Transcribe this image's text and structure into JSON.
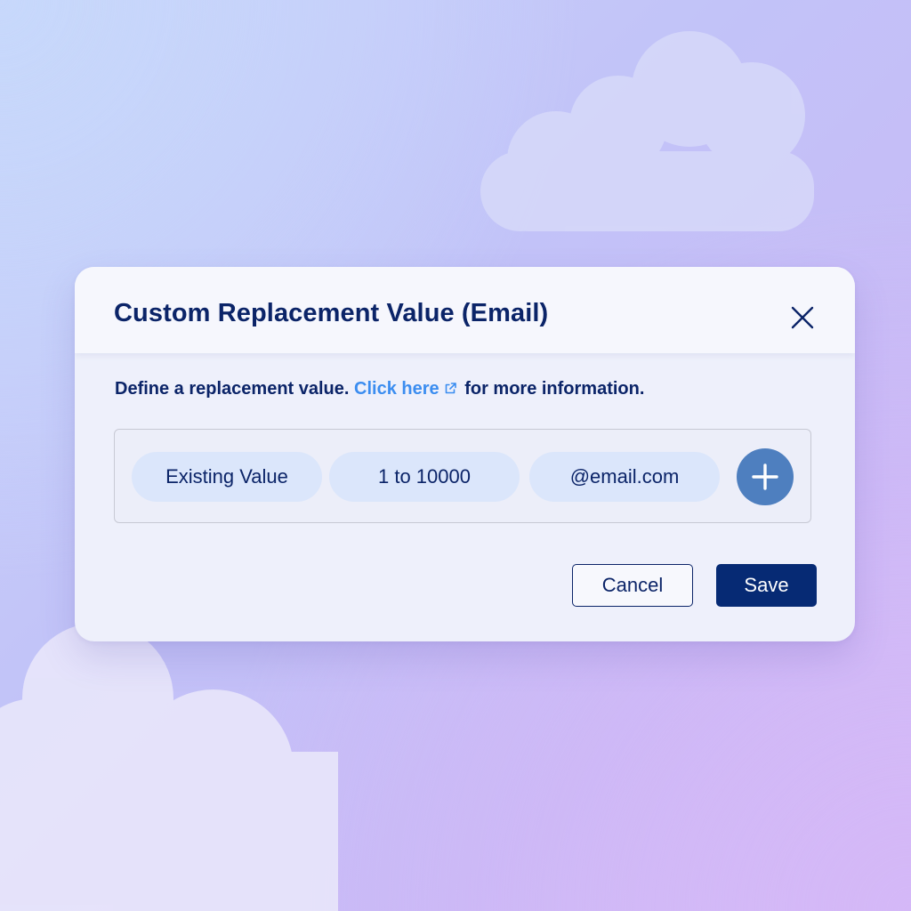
{
  "dialog": {
    "title": "Custom Replacement Value (Email)",
    "description_prefix": "Define a replacement value.",
    "link_label": "Click here",
    "description_suffix": "for more information."
  },
  "value_builder": {
    "tokens": [
      "Existing Value",
      "1 to 10000",
      "@email.com"
    ],
    "add_icon": "plus-icon"
  },
  "actions": {
    "cancel_label": "Cancel",
    "save_label": "Save"
  },
  "colors": {
    "navy": "#0b2468",
    "link": "#3b8df0",
    "pill_bg": "#dbe6fb",
    "add_button": "#4e7fbf",
    "save_bg": "#062a74"
  }
}
